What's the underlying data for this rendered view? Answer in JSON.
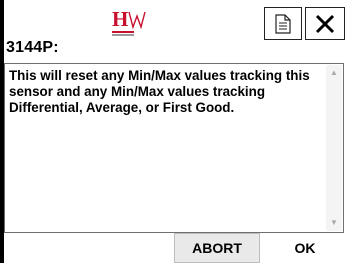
{
  "header": {
    "logo_text": "HW",
    "sensor_id": "3144P:"
  },
  "toolbar": {
    "document_icon": "document-icon",
    "close_icon": "close-icon"
  },
  "message": {
    "text": "This will reset any Min/Max values tracking this sensor and any Min/Max values tracking Differential, Average, or First Good."
  },
  "buttons": {
    "abort_label": "ABORT",
    "ok_label": "OK"
  },
  "colors": {
    "logo_red": "#c8102e",
    "logo_gray": "#9a9a9a",
    "abort_bg": "#e9e9e9",
    "text": "#000000"
  }
}
